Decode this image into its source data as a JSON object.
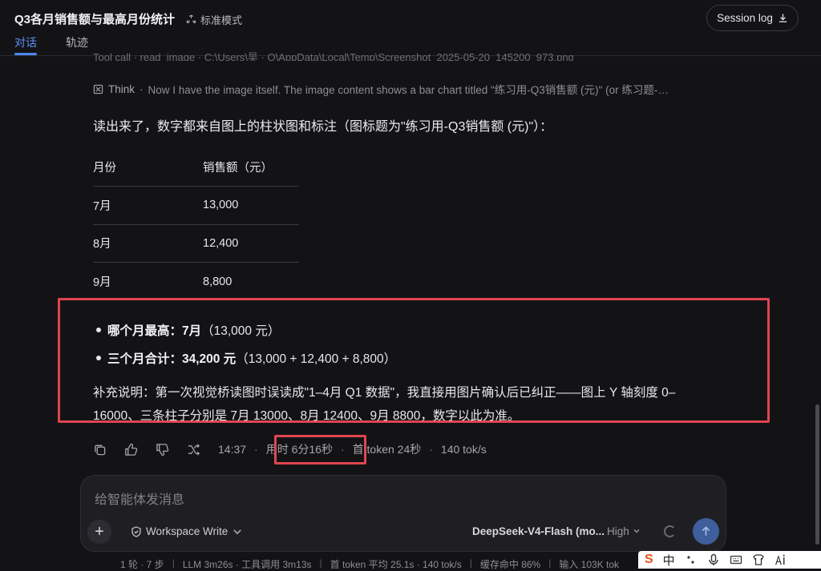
{
  "header": {
    "title": "Q3各月销售额与最高月份统计",
    "mode_label": "标准模式",
    "session_log_label": "Session log"
  },
  "tabs": [
    {
      "label": "对话",
      "active": true
    },
    {
      "label": "轨迹",
      "active": false
    }
  ],
  "clipped_tool_line": "Tool call · read_image · C:\\Users\\吴 · Q\\AppData\\Local\\Temp\\Screenshot_2025-05-20_145200_973.png",
  "think": {
    "label": "Think",
    "text": "Now I have the image itself. The image content shows a bar chart titled \"练习用-Q3销售额 (元)\" (or 练习题-…"
  },
  "message": {
    "intro": "读出来了，数字都来自图上的柱状图和标注（图标题为\"练习用-Q3销售额 (元)\"）：",
    "table": {
      "headers": [
        "月份",
        "销售额（元）"
      ],
      "rows": [
        [
          "7月",
          "13,000"
        ],
        [
          "8月",
          "12,400"
        ],
        [
          "9月",
          "8,800"
        ]
      ]
    },
    "bullets": [
      {
        "bold": "哪个月最高：7月",
        "rest": "（13,000 元）"
      },
      {
        "bold": "三个月合计：34,200 元",
        "rest": "（13,000 + 12,400 + 8,800）"
      }
    ],
    "note": "补充说明：第一次视觉桥读图时误读成\"1–4月 Q1 数据\"，我直接用图片确认后已纠正——图上 Y 轴刻度 0–16000、三条柱子分别是 7月 13000、8月 12400、9月 8800，数字以此为准。"
  },
  "meta": {
    "time": "14:37",
    "duration": "用时 6分16秒",
    "first_token": "首 token 24秒",
    "speed": "140 tok/s"
  },
  "composer": {
    "placeholder": "给智能体发消息",
    "workspace_label": "Workspace Write",
    "model_label": "DeepSeek-V4-Flash (mo...",
    "effort_label": "High"
  },
  "statusbar": [
    "1 轮 · 7 步",
    "LLM 3m26s · 工具调用 3m13s",
    "首 token 平均 25.1s · 140 tok/s",
    "缓存命中 86%",
    "输入 103K tok"
  ],
  "ime": {
    "brand": "S",
    "lang": "中"
  },
  "colors": {
    "background": "#131316",
    "accent": "#4f86ef",
    "highlight_border": "#e0454f",
    "send_button": "#3e5f9c"
  }
}
